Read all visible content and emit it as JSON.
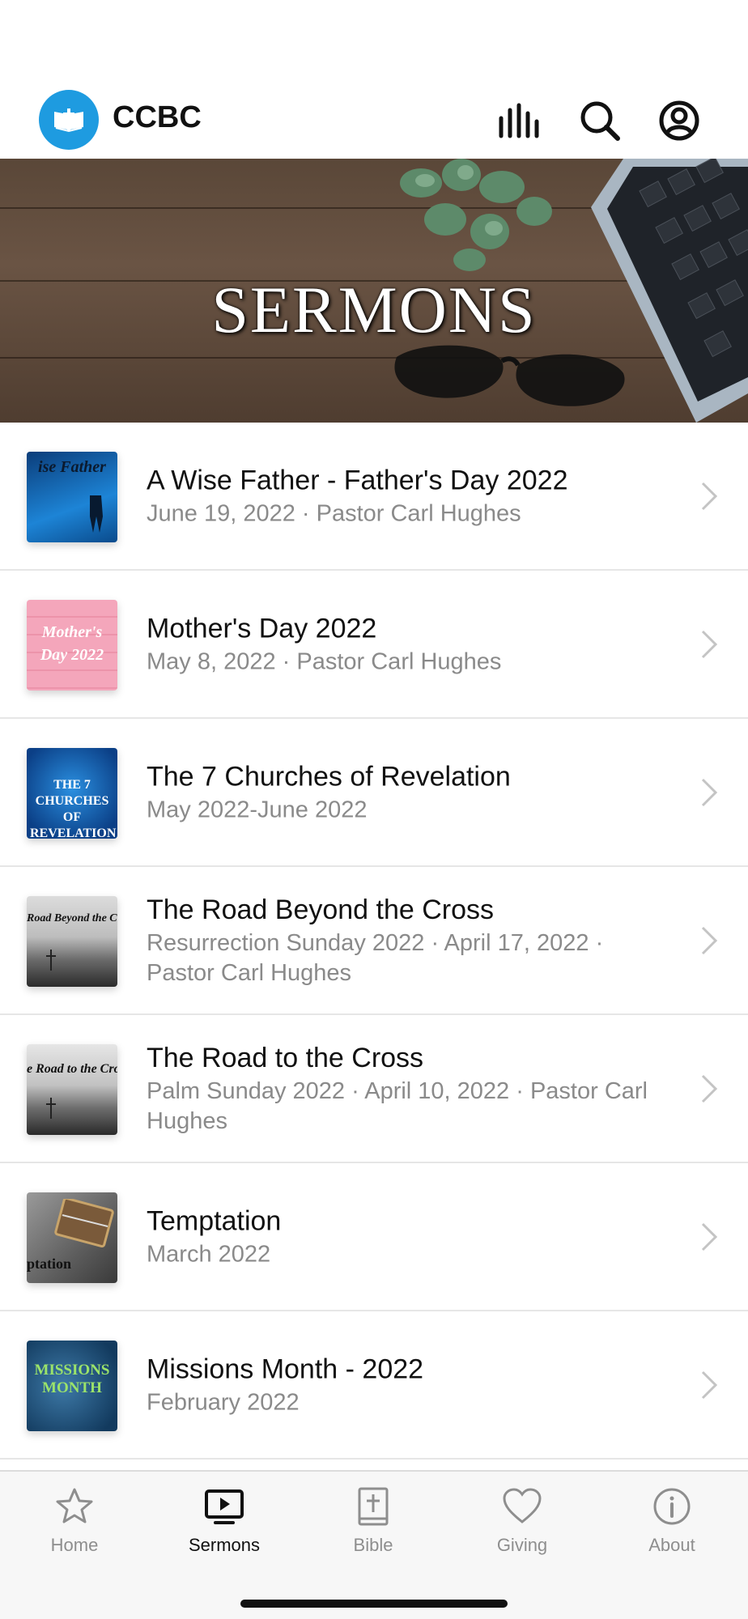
{
  "header": {
    "app_title": "CCBC",
    "icons": [
      "audio-bars-icon",
      "search-icon",
      "account-icon"
    ]
  },
  "banner": {
    "title": "SERMONS"
  },
  "sermons": [
    {
      "title": "A Wise Father - Father's Day 2022",
      "subtitle": "June 19, 2022 · Pastor Carl Hughes",
      "thumb_text": "ise Father"
    },
    {
      "title": "Mother's Day 2022",
      "subtitle": "May 8, 2022 · Pastor Carl Hughes",
      "thumb_text": "Mother's Day 2022"
    },
    {
      "title": "The 7 Churches of Revelation",
      "subtitle": "May 2022-June 2022",
      "thumb_text": "THE 7 CHURCHES OF REVELATION"
    },
    {
      "title": "The Road Beyond the Cross",
      "subtitle": "Resurrection Sunday 2022 · April 17, 2022 · Pastor Carl Hughes",
      "thumb_text": "Road Beyond the Cross"
    },
    {
      "title": "The Road to the Cross",
      "subtitle": "Palm Sunday 2022 · April 10, 2022 · Pastor Carl Hughes",
      "thumb_text": "e Road to the Cross"
    },
    {
      "title": "Temptation",
      "subtitle": "March 2022",
      "thumb_text": "ptation"
    },
    {
      "title": "Missions Month - 2022",
      "subtitle": "February 2022",
      "thumb_text": "MISSIONS MONTH"
    }
  ],
  "tabs": [
    {
      "label": "Home",
      "icon": "star-icon",
      "active": false
    },
    {
      "label": "Sermons",
      "icon": "tv-play-icon",
      "active": true
    },
    {
      "label": "Bible",
      "icon": "bible-icon",
      "active": false
    },
    {
      "label": "Giving",
      "icon": "heart-icon",
      "active": false
    },
    {
      "label": "About",
      "icon": "info-icon",
      "active": false
    }
  ],
  "colors": {
    "brand": "#1e9be0",
    "tab_active": "#111111",
    "tab_inactive": "#8e8e8e"
  }
}
